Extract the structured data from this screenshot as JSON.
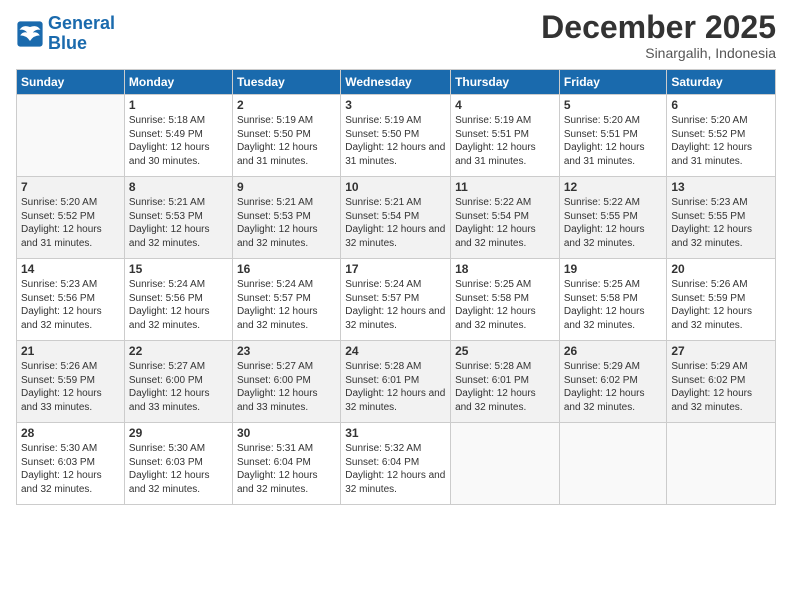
{
  "logo": {
    "line1": "General",
    "line2": "Blue"
  },
  "title": "December 2025",
  "location": "Sinargalih, Indonesia",
  "weekdays": [
    "Sunday",
    "Monday",
    "Tuesday",
    "Wednesday",
    "Thursday",
    "Friday",
    "Saturday"
  ],
  "rows": [
    [
      {
        "day": "",
        "empty": true
      },
      {
        "day": "1",
        "sunrise": "5:18 AM",
        "sunset": "5:49 PM",
        "daylight": "12 hours and 30 minutes."
      },
      {
        "day": "2",
        "sunrise": "5:19 AM",
        "sunset": "5:50 PM",
        "daylight": "12 hours and 31 minutes."
      },
      {
        "day": "3",
        "sunrise": "5:19 AM",
        "sunset": "5:50 PM",
        "daylight": "12 hours and 31 minutes."
      },
      {
        "day": "4",
        "sunrise": "5:19 AM",
        "sunset": "5:51 PM",
        "daylight": "12 hours and 31 minutes."
      },
      {
        "day": "5",
        "sunrise": "5:20 AM",
        "sunset": "5:51 PM",
        "daylight": "12 hours and 31 minutes."
      },
      {
        "day": "6",
        "sunrise": "5:20 AM",
        "sunset": "5:52 PM",
        "daylight": "12 hours and 31 minutes."
      }
    ],
    [
      {
        "day": "7",
        "sunrise": "5:20 AM",
        "sunset": "5:52 PM",
        "daylight": "12 hours and 31 minutes."
      },
      {
        "day": "8",
        "sunrise": "5:21 AM",
        "sunset": "5:53 PM",
        "daylight": "12 hours and 32 minutes."
      },
      {
        "day": "9",
        "sunrise": "5:21 AM",
        "sunset": "5:53 PM",
        "daylight": "12 hours and 32 minutes."
      },
      {
        "day": "10",
        "sunrise": "5:21 AM",
        "sunset": "5:54 PM",
        "daylight": "12 hours and 32 minutes."
      },
      {
        "day": "11",
        "sunrise": "5:22 AM",
        "sunset": "5:54 PM",
        "daylight": "12 hours and 32 minutes."
      },
      {
        "day": "12",
        "sunrise": "5:22 AM",
        "sunset": "5:55 PM",
        "daylight": "12 hours and 32 minutes."
      },
      {
        "day": "13",
        "sunrise": "5:23 AM",
        "sunset": "5:55 PM",
        "daylight": "12 hours and 32 minutes."
      }
    ],
    [
      {
        "day": "14",
        "sunrise": "5:23 AM",
        "sunset": "5:56 PM",
        "daylight": "12 hours and 32 minutes."
      },
      {
        "day": "15",
        "sunrise": "5:24 AM",
        "sunset": "5:56 PM",
        "daylight": "12 hours and 32 minutes."
      },
      {
        "day": "16",
        "sunrise": "5:24 AM",
        "sunset": "5:57 PM",
        "daylight": "12 hours and 32 minutes."
      },
      {
        "day": "17",
        "sunrise": "5:24 AM",
        "sunset": "5:57 PM",
        "daylight": "12 hours and 32 minutes."
      },
      {
        "day": "18",
        "sunrise": "5:25 AM",
        "sunset": "5:58 PM",
        "daylight": "12 hours and 32 minutes."
      },
      {
        "day": "19",
        "sunrise": "5:25 AM",
        "sunset": "5:58 PM",
        "daylight": "12 hours and 32 minutes."
      },
      {
        "day": "20",
        "sunrise": "5:26 AM",
        "sunset": "5:59 PM",
        "daylight": "12 hours and 32 minutes."
      }
    ],
    [
      {
        "day": "21",
        "sunrise": "5:26 AM",
        "sunset": "5:59 PM",
        "daylight": "12 hours and 33 minutes."
      },
      {
        "day": "22",
        "sunrise": "5:27 AM",
        "sunset": "6:00 PM",
        "daylight": "12 hours and 33 minutes."
      },
      {
        "day": "23",
        "sunrise": "5:27 AM",
        "sunset": "6:00 PM",
        "daylight": "12 hours and 33 minutes."
      },
      {
        "day": "24",
        "sunrise": "5:28 AM",
        "sunset": "6:01 PM",
        "daylight": "12 hours and 32 minutes."
      },
      {
        "day": "25",
        "sunrise": "5:28 AM",
        "sunset": "6:01 PM",
        "daylight": "12 hours and 32 minutes."
      },
      {
        "day": "26",
        "sunrise": "5:29 AM",
        "sunset": "6:02 PM",
        "daylight": "12 hours and 32 minutes."
      },
      {
        "day": "27",
        "sunrise": "5:29 AM",
        "sunset": "6:02 PM",
        "daylight": "12 hours and 32 minutes."
      }
    ],
    [
      {
        "day": "28",
        "sunrise": "5:30 AM",
        "sunset": "6:03 PM",
        "daylight": "12 hours and 32 minutes."
      },
      {
        "day": "29",
        "sunrise": "5:30 AM",
        "sunset": "6:03 PM",
        "daylight": "12 hours and 32 minutes."
      },
      {
        "day": "30",
        "sunrise": "5:31 AM",
        "sunset": "6:04 PM",
        "daylight": "12 hours and 32 minutes."
      },
      {
        "day": "31",
        "sunrise": "5:32 AM",
        "sunset": "6:04 PM",
        "daylight": "12 hours and 32 minutes."
      },
      {
        "day": "",
        "empty": true
      },
      {
        "day": "",
        "empty": true
      },
      {
        "day": "",
        "empty": true
      }
    ]
  ]
}
